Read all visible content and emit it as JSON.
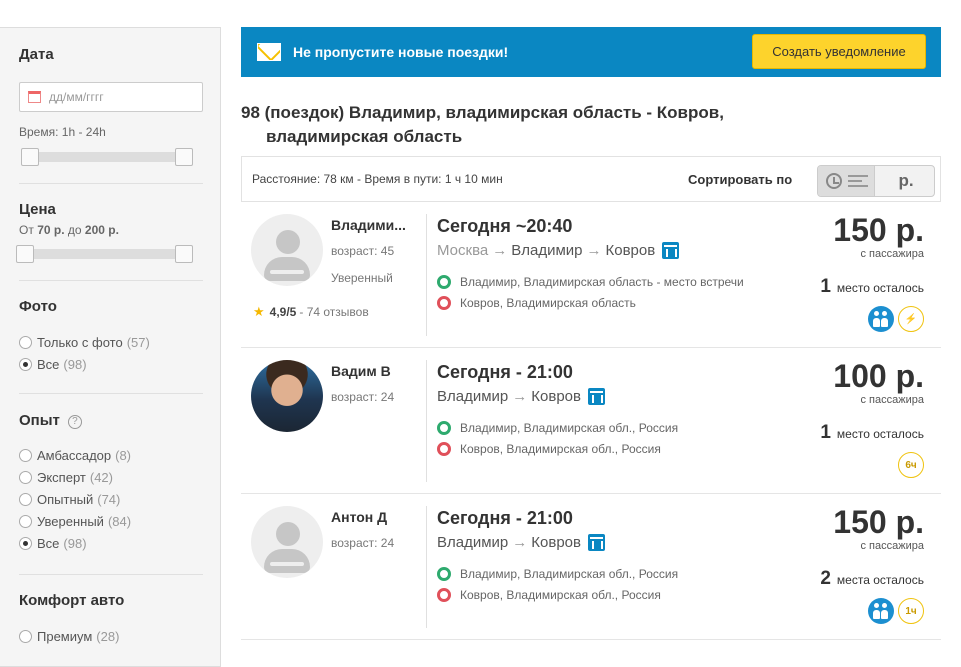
{
  "sidebar": {
    "date": {
      "title": "Дата",
      "placeholder": "дд/мм/гггг",
      "time_label": "Время: 1h - 24h"
    },
    "price": {
      "title": "Цена",
      "from_label": "От",
      "from_value": "70 р.",
      "to_label": "до",
      "to_value": "200 р."
    },
    "photo": {
      "title": "Фото",
      "options": [
        {
          "label": "Только с фото",
          "count": "(57)",
          "selected": false
        },
        {
          "label": "Все",
          "count": "(98)",
          "selected": true
        }
      ]
    },
    "experience": {
      "title": "Опыт",
      "help": "?",
      "options": [
        {
          "label": "Амбассадор",
          "count": "(8)",
          "selected": false
        },
        {
          "label": "Эксперт",
          "count": "(42)",
          "selected": false
        },
        {
          "label": "Опытный",
          "count": "(74)",
          "selected": false
        },
        {
          "label": "Уверенный",
          "count": "(84)",
          "selected": false
        },
        {
          "label": "Все",
          "count": "(98)",
          "selected": true
        }
      ]
    },
    "comfort": {
      "title": "Комфорт авто",
      "options": [
        {
          "label": "Премиум",
          "count": "(28)",
          "selected": false
        }
      ]
    }
  },
  "banner": {
    "text": "Не пропустите новые поездки!",
    "button": "Создать уведомление"
  },
  "results": {
    "title_line1": "98 (поездок) Владимир, владимирская область - Ковров,",
    "title_line2": "владимирская область"
  },
  "sortbar": {
    "distance": "Расстояние: 78 км - Время в пути: 1 ч 10 мин",
    "sort_label": "Сортировать по",
    "price_option": "р."
  },
  "trips": [
    {
      "driver": {
        "name": "Владими...",
        "age": "возраст: 45",
        "level": "Уверенный",
        "rating": "4,9/5",
        "reviews": "- 74 отзывов"
      },
      "time": "Сегодня ~20:40",
      "route_from": "Москва",
      "route_mid": "Владимир",
      "route_to": "Ковров",
      "pickup": "Владимир, Владимирская область - место встречи",
      "dropoff": "Ковров, Владимирская область",
      "price": "150 р.",
      "per": "с пассажира",
      "seats_num": "1",
      "seats_text": "место осталось",
      "badge_text": "⚡"
    },
    {
      "driver": {
        "name": "Вадим В",
        "age": "возраст: 24"
      },
      "time": "Сегодня - 21:00",
      "route_from": "Владимир",
      "route_to": "Ковров",
      "pickup": "Владимир, Владимирская обл., Россия",
      "dropoff": "Ковров, Владимирская обл., Россия",
      "price": "100 р.",
      "per": "с пассажира",
      "seats_num": "1",
      "seats_text": "место осталось",
      "badge_text": "6ч"
    },
    {
      "driver": {
        "name": "Антон Д",
        "age": "возраст: 24"
      },
      "time": "Сегодня - 21:00",
      "route_from": "Владимир",
      "route_to": "Ковров",
      "pickup": "Владимир, Владимирская обл., Россия",
      "dropoff": "Ковров, Владимирская обл., Россия",
      "price": "150 р.",
      "per": "с пассажира",
      "seats_num": "2",
      "seats_text": "места осталось",
      "badge_text": "1ч"
    }
  ],
  "colors": {
    "accent_blue": "#0a87c2",
    "button_yellow": "#fdd32c",
    "pickup_green": "#2eaa6e",
    "dropoff_red": "#e0505a"
  }
}
